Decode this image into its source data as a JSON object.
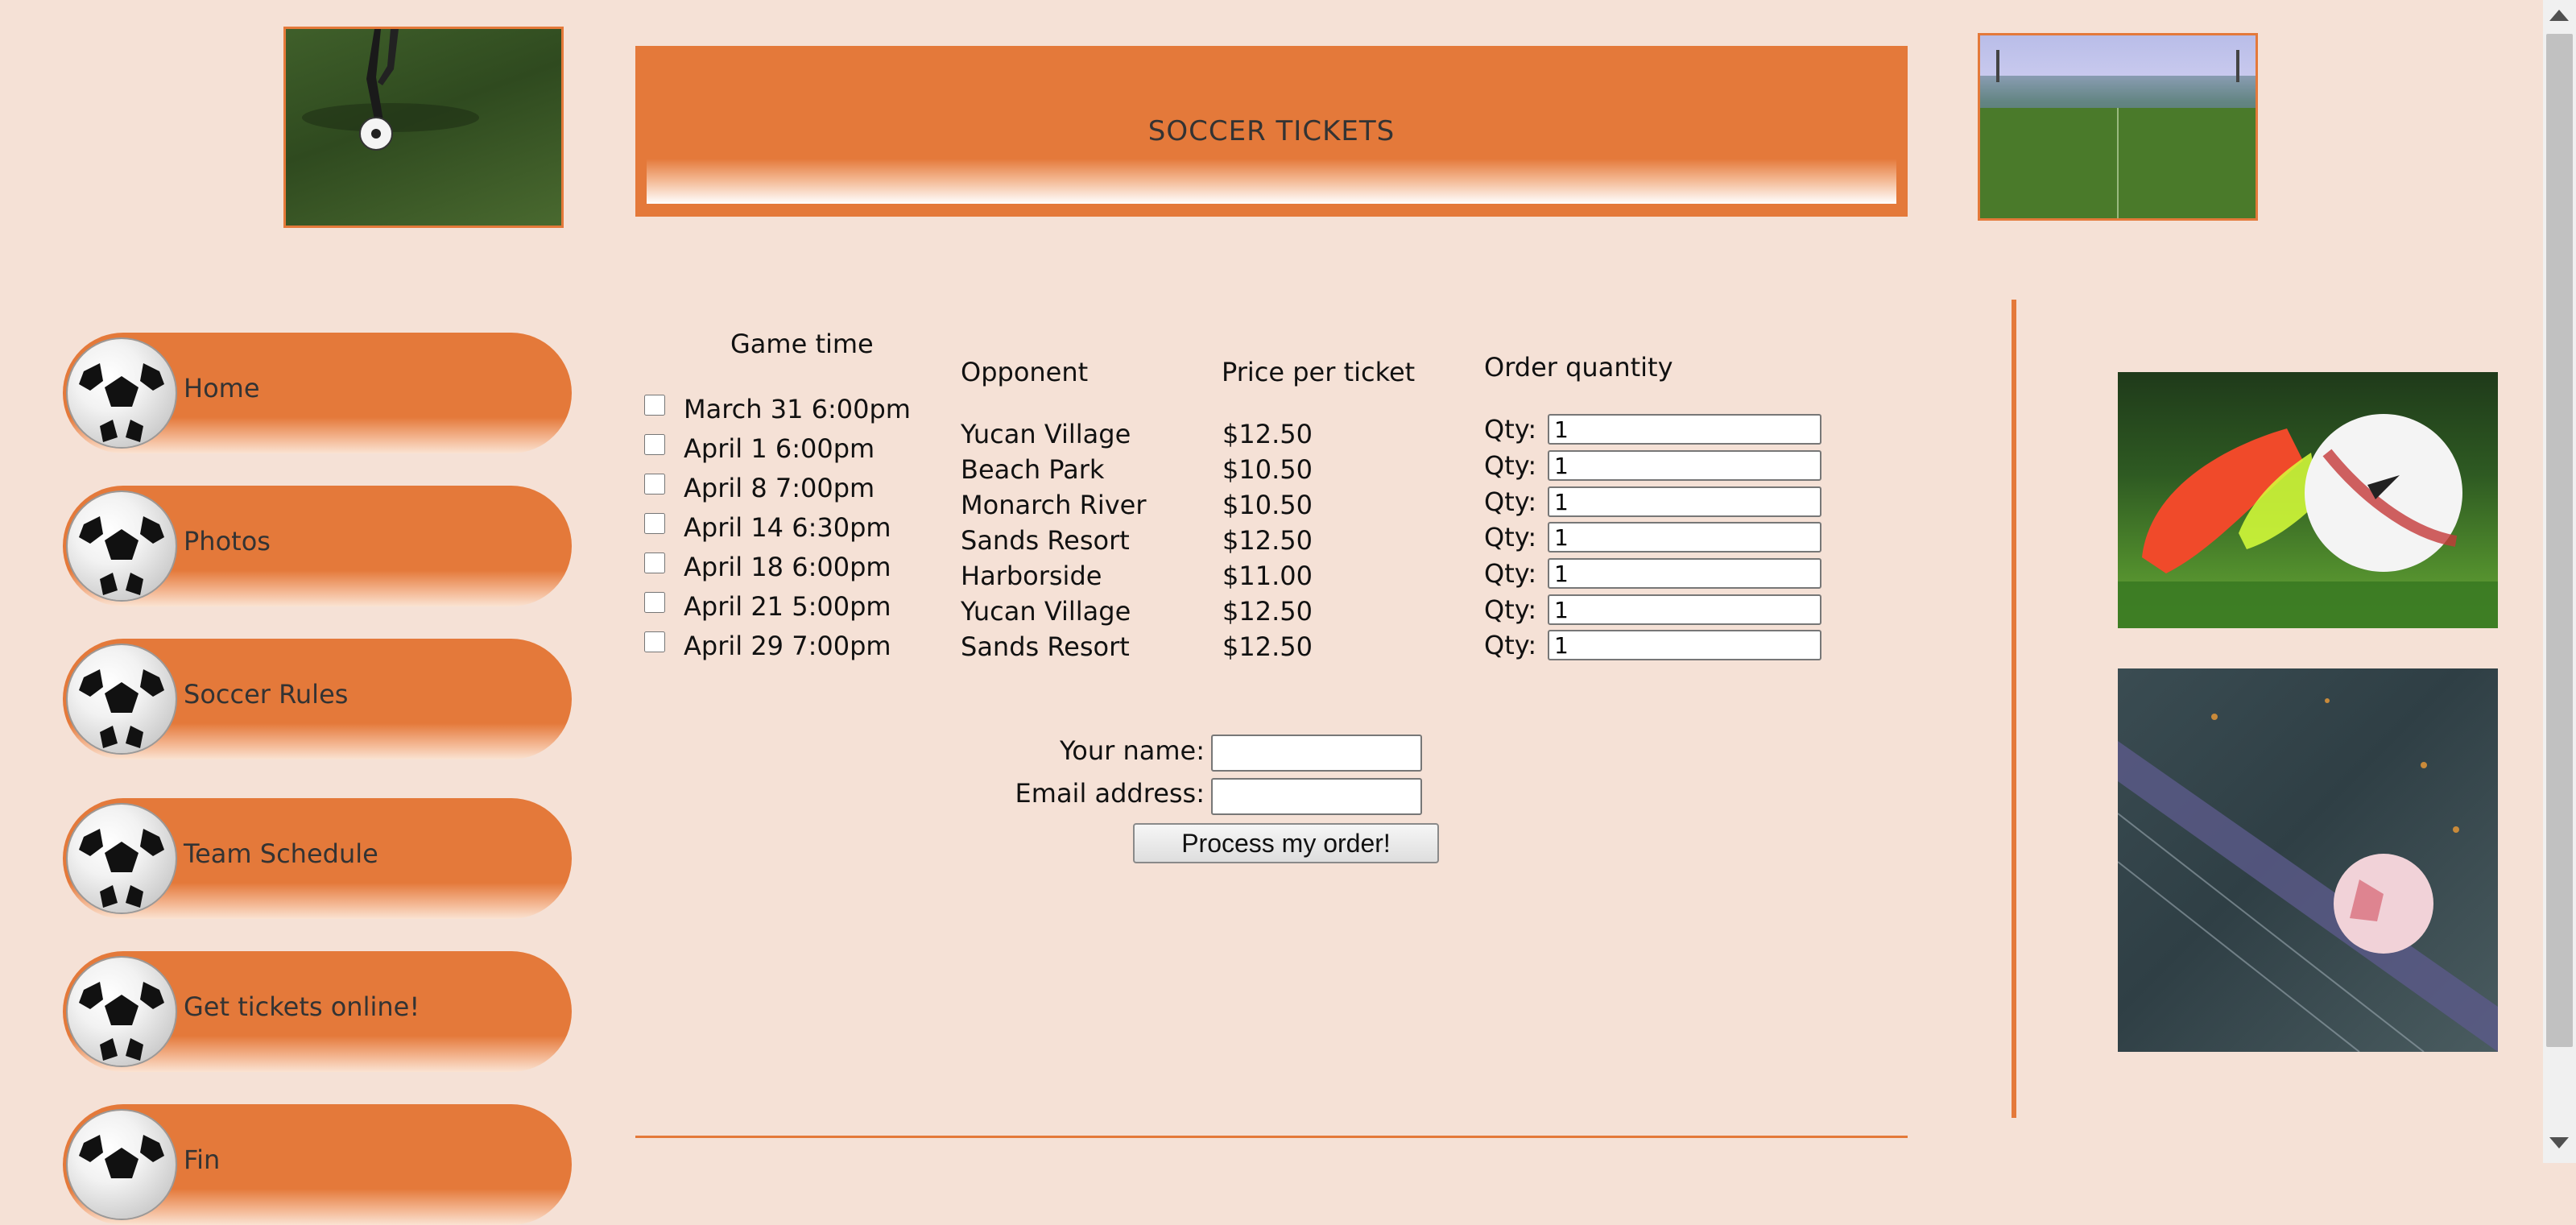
{
  "banner": {
    "title": "SOCCER TICKETS"
  },
  "images": {
    "top_left": "player-kicking-ball-photo",
    "top_right": "stadium-photo",
    "right_1": "cleats-and-ball-on-grass-photo",
    "right_2": "ball-by-goal-net-photo"
  },
  "nav": {
    "items": [
      {
        "label": "Home"
      },
      {
        "label": "Photos"
      },
      {
        "label": "Soccer Rules"
      },
      {
        "label": "Team Schedule"
      },
      {
        "label": "Get tickets online!"
      },
      {
        "label": "Fin"
      }
    ]
  },
  "table": {
    "headers": {
      "game_time": "Game time",
      "opponent": "Opponent",
      "price": "Price per ticket",
      "quantity": "Order quantity"
    },
    "qty_label": "Qty:",
    "rows": [
      {
        "time": "March 31 6:00pm",
        "opponent": "Yucan Village",
        "price": "$12.50",
        "qty": "1"
      },
      {
        "time": "April 1 6:00pm",
        "opponent": "Beach Park",
        "price": "$10.50",
        "qty": "1"
      },
      {
        "time": "April 8 7:00pm",
        "opponent": "Monarch River",
        "price": "$10.50",
        "qty": "1"
      },
      {
        "time": "April 14 6:30pm",
        "opponent": "Sands Resort",
        "price": "$12.50",
        "qty": "1"
      },
      {
        "time": "April 18 6:00pm",
        "opponent": "Harborside",
        "price": "$11.00",
        "qty": "1"
      },
      {
        "time": "April 21 5:00pm",
        "opponent": "Yucan Village",
        "price": "$12.50",
        "qty": "1"
      },
      {
        "time": "April 29 7:00pm",
        "opponent": "Sands Resort",
        "price": "$12.50",
        "qty": "1"
      }
    ]
  },
  "form": {
    "name_label": "Your name:",
    "email_label": "Email address:",
    "name_value": "",
    "email_value": "",
    "submit_label": "Process my order!"
  },
  "colors": {
    "background": "#f5e1d6",
    "accent": "#e4793a"
  }
}
